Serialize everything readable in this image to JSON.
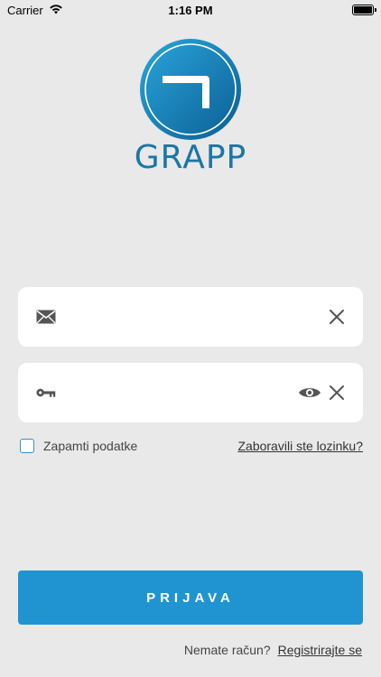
{
  "status_bar": {
    "carrier": "Carrier",
    "time": "1:16 PM"
  },
  "brand": {
    "name": "GRAPP",
    "color": "#1b76a6"
  },
  "email_field": {
    "value": "",
    "placeholder": "",
    "icon": "envelope-icon",
    "clear_icon": "close-icon"
  },
  "password_field": {
    "value": "",
    "placeholder": "",
    "icon": "key-icon",
    "toggle_icon": "eye-icon",
    "clear_icon": "close-icon"
  },
  "remember": {
    "label": "Zapamti podatke",
    "checked": false
  },
  "forgot_password": {
    "label": "Zaboravili ste lozinku?"
  },
  "login_button": {
    "label": "PRIJAVA",
    "color": "#1f94d1"
  },
  "register": {
    "prompt": "Nemate račun?",
    "link": "Registrirajte se"
  }
}
